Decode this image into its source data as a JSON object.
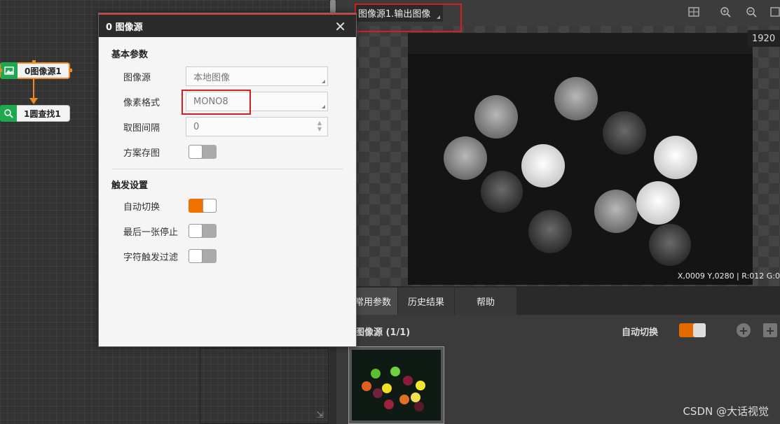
{
  "flow": {
    "nodes": [
      {
        "label": "0图像源1",
        "icon": "image-icon"
      },
      {
        "label": "1圆查找1",
        "icon": "circle-search-icon"
      }
    ]
  },
  "dialog": {
    "title": "0 图像源",
    "close_glyph": "✕",
    "sections": {
      "basic": "基本参数",
      "trigger": "触发设置"
    },
    "fields": {
      "image_source": {
        "label": "图像源",
        "value": "本地图像"
      },
      "pixel_format": {
        "label": "像素格式",
        "value": "MONO8"
      },
      "interval": {
        "label": "取图间隔",
        "value": "0"
      },
      "save_scheme_image": {
        "label": "方案存图",
        "checked": false
      }
    },
    "trigger": {
      "auto_switch": {
        "label": "自动切换",
        "checked": true
      },
      "stop_last": {
        "label": "最后一张停止",
        "checked": false
      },
      "char_filter": {
        "label": "字符触发过滤",
        "checked": false
      }
    }
  },
  "viewer": {
    "source_select": "图像源1.输出图像",
    "resolution": "1920",
    "pixel_readout": "X,0009  Y,0280  |  R:012  G:0",
    "tabs": [
      "常用参数",
      "历史结果",
      "帮助"
    ],
    "source_count": "图像源 (1/1)",
    "auto_switch_label": "自动切换",
    "add_glyph": "+",
    "watermark": "CSDN @大话视觉"
  },
  "colors": {
    "accent": "#f07000",
    "highlight": "#d21f1f"
  }
}
